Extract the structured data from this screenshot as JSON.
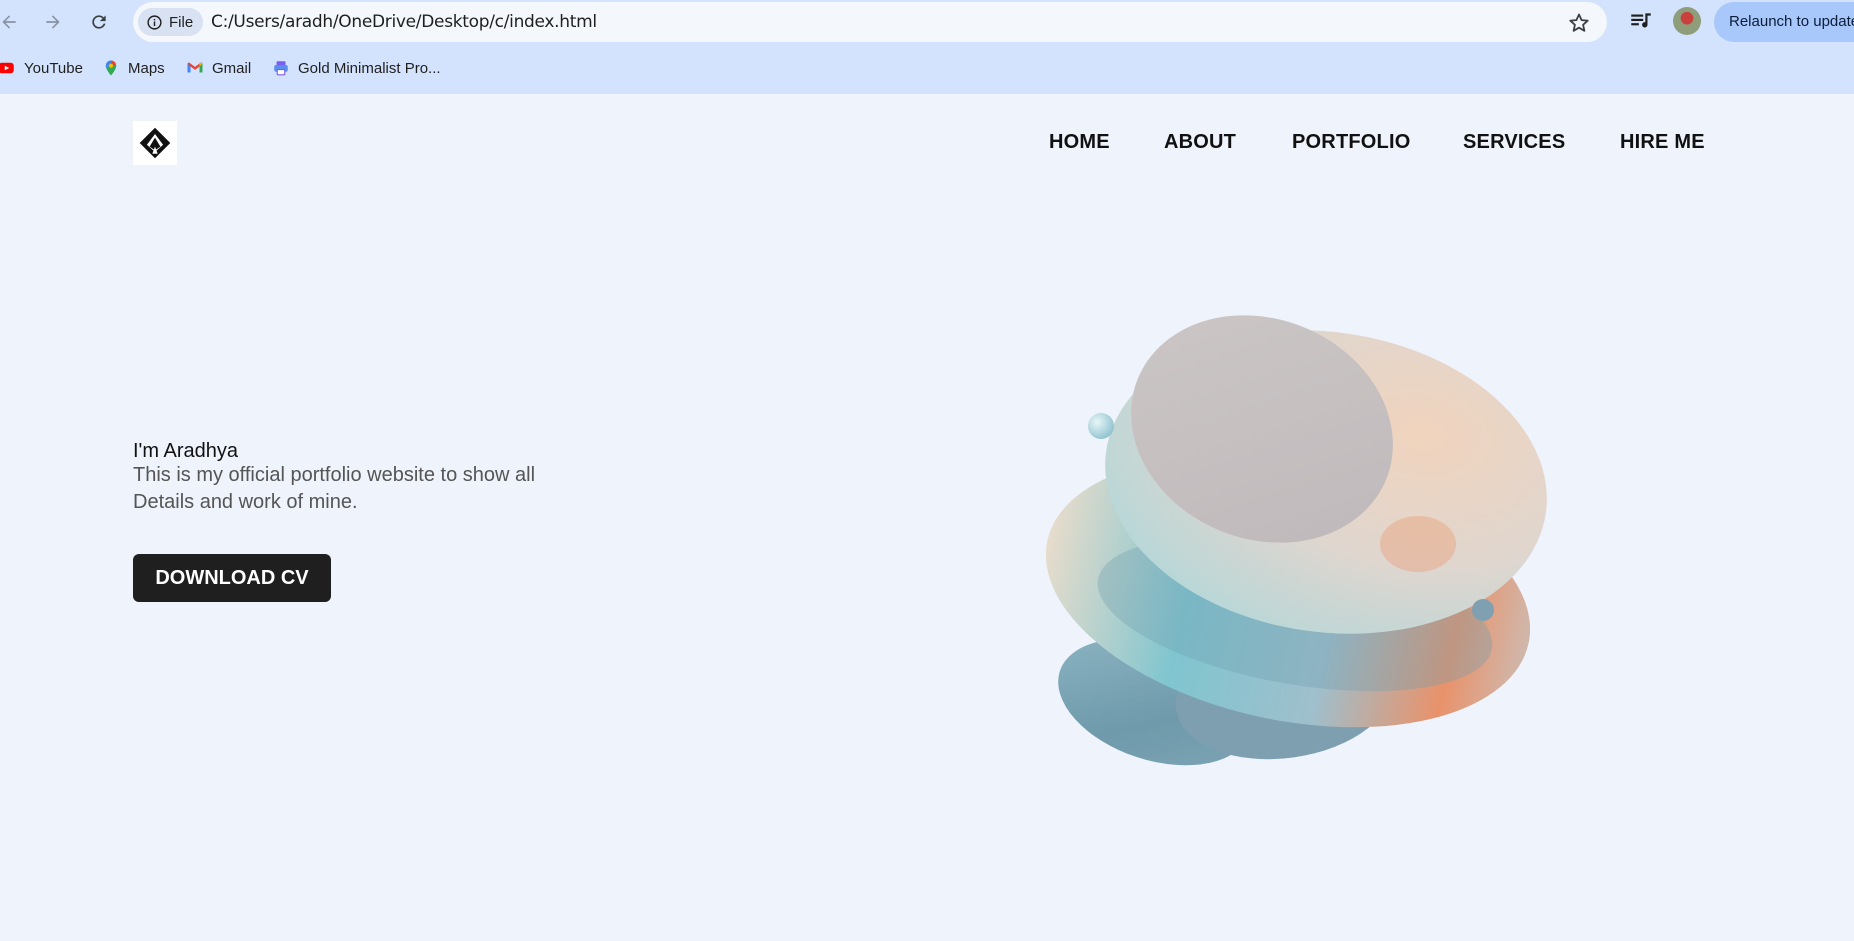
{
  "browser": {
    "file_chip_label": "File",
    "url": "C:/Users/aradh/OneDrive/Desktop/c/index.html",
    "relaunch_label": "Relaunch to update",
    "bookmarks": [
      "YouTube",
      "Maps",
      "Gmail",
      "Gold Minimalist Pro..."
    ]
  },
  "site": {
    "nav": [
      "HOME",
      "ABOUT",
      "PORTFOLIO",
      "SERVICES",
      "HIRE ME"
    ],
    "intro": "I'm Aradhya",
    "tagline": "This is my official portfolio website to show all Details and work of mine.",
    "cta_label": "DOWNLOAD CV"
  },
  "icons": {
    "back": "arrow-left-icon",
    "forward": "arrow-right-icon",
    "reload": "reload-icon",
    "info": "info-icon",
    "bookmark_star": "star-icon",
    "media": "media-queue-icon"
  },
  "colors": {
    "page_background": "#eef3fc",
    "chrome_background": "#d3e3fd",
    "cta_background": "#1f1f1f",
    "relaunch_background": "#a8c7fa"
  }
}
